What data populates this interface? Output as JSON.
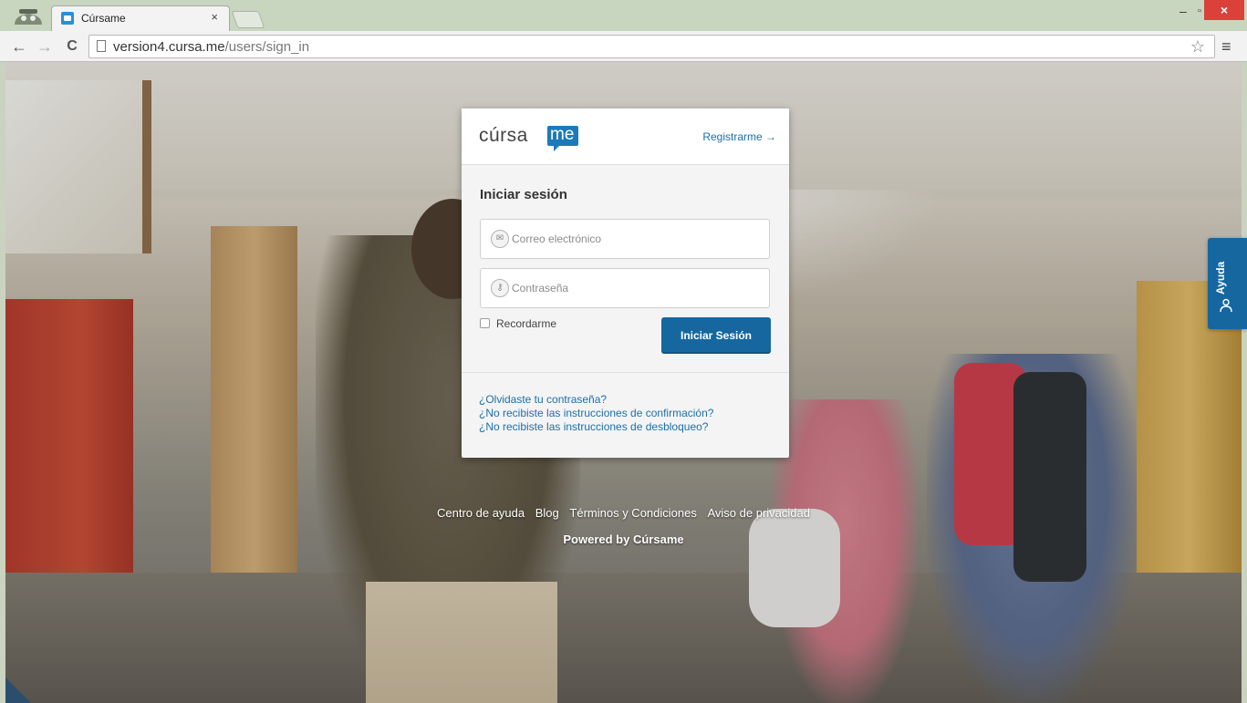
{
  "browser": {
    "tab_title": "Cúrsame",
    "tab_close": "×",
    "url_host": "version4.cursa.me",
    "url_path": "/users/sign_in",
    "window_min": "–",
    "window_max": "▫",
    "window_close": "×",
    "back": "←",
    "forward": "→",
    "reload": "C",
    "star": "☆",
    "menu": "≡"
  },
  "card": {
    "logo_text": "cúrsa",
    "logo_badge": "me",
    "register_link": "Registrarme →",
    "title": "Iniciar sesión",
    "email_placeholder": "Correo electrónico",
    "password_placeholder": "Contraseña",
    "remember_label": "Recordarme",
    "login_button": "Iniciar Sesión",
    "help_links": [
      "¿Olvidaste tu contraseña?",
      "¿No recibiste las instrucciones de confirmación?",
      "¿No recibiste las instrucciones de desbloqueo?"
    ]
  },
  "footer": {
    "links": [
      "Centro de ayuda",
      "Blog",
      "Términos y Condiciones",
      "Aviso de privacidad"
    ],
    "powered": "Powered by Cúrsame"
  },
  "help_tab": {
    "label": "Ayuda",
    "icon": "person-icon"
  },
  "colors": {
    "brand_blue": "#1667a0",
    "link_blue": "#1d6fa8",
    "window_close_red": "#d9413a"
  }
}
